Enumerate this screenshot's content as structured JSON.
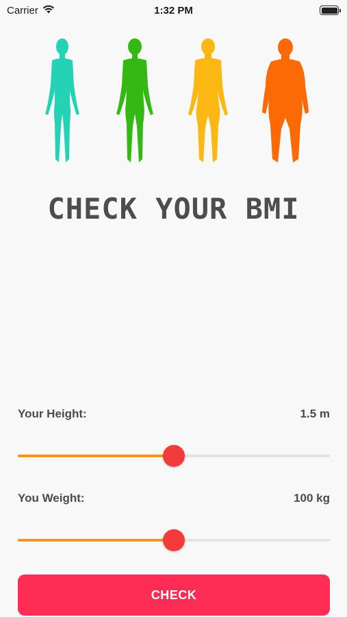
{
  "status_bar": {
    "carrier": "Carrier",
    "time": "1:32 PM",
    "icons": [
      "wifi-icon",
      "battery-icon"
    ]
  },
  "figures": [
    {
      "icon": "slim-body-icon",
      "color": "#24d3b5"
    },
    {
      "icon": "normal-body-icon",
      "color": "#33b814"
    },
    {
      "icon": "overweight-body-icon",
      "color": "#fdb713"
    },
    {
      "icon": "obese-body-icon",
      "color": "#fc6a06"
    }
  ],
  "title": "CHECK YOUR BMI",
  "height": {
    "label": "Your Height:",
    "value_text": "1.5 m",
    "fraction": 0.5
  },
  "weight": {
    "label": "You Weight:",
    "value_text": "100 kg",
    "fraction": 0.5
  },
  "check_button": {
    "label": "CHECK"
  },
  "colors": {
    "slider_fill": "#f5941e",
    "slider_thumb": "#f43b3b",
    "button": "#ff2d55",
    "title": "#4d4d4d"
  }
}
